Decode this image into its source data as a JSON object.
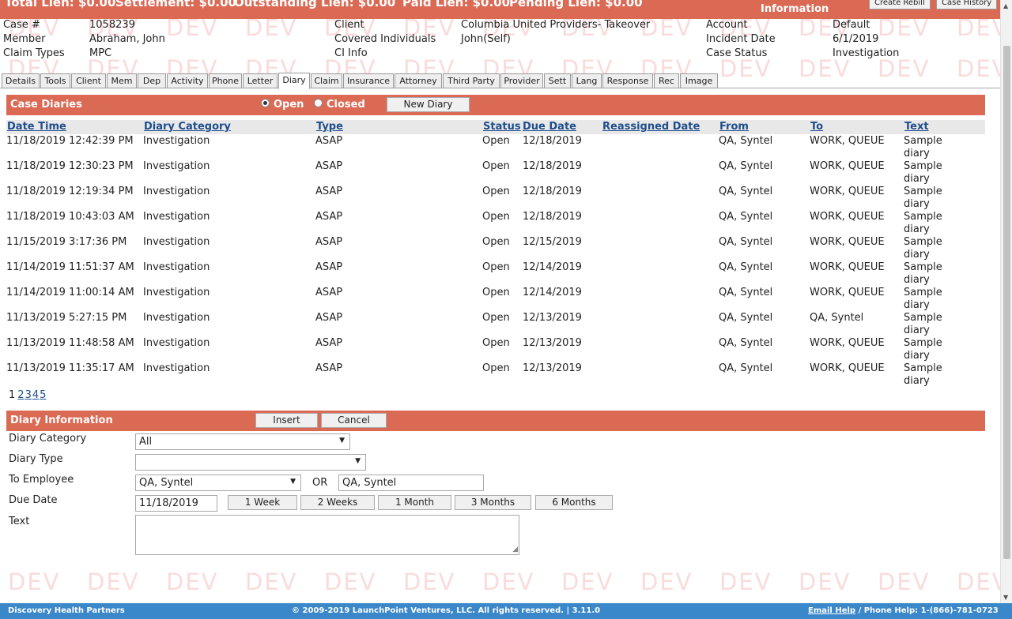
{
  "watermark": "DEV",
  "summary": {
    "total_lien": "Total Lien: $0.00",
    "settlement": "Settlement: $0.00",
    "outstanding_lien": "Outstanding Lien: $0.00",
    "paid_lien": "Paid Lien: $0.00",
    "pending_lien": "Pending Lien: $0.00",
    "information_title": "Information",
    "create_rebill": "Create Rebill",
    "case_history": "Case History"
  },
  "case_info": {
    "case_label": "Case #",
    "case_value": "1058239",
    "member_label": "Member",
    "member_value": "Abraham, John",
    "claim_types_label": "Claim Types",
    "claim_types_value": "MPC",
    "client_label": "Client",
    "client_value": "Columbia United Providers- Takeover",
    "covered_label": "Covered Individuals",
    "covered_value": "John(Self)",
    "ci_info_label": "CI Info",
    "account_label": "Account",
    "account_value": "Default",
    "incident_label": "Incident Date",
    "incident_value": "6/1/2019",
    "status_label": "Case Status",
    "status_value": "Investigation"
  },
  "tabs": [
    "Details",
    "Tools",
    "Client",
    "Mem",
    "Dep",
    "Activity",
    "Phone",
    "Letter",
    "Diary",
    "Claim",
    "Insurance",
    "Attorney",
    "Third Party",
    "Provider",
    "Sett",
    "Lang",
    "Response",
    "Rec",
    "Image"
  ],
  "case_diaries": {
    "title": "Case Diaries",
    "open_label": "Open",
    "closed_label": "Closed",
    "new_diary": "New Diary",
    "columns": [
      "Date Time",
      "Diary Category",
      "Type",
      "Status",
      "Due Date",
      "Reassigned Date",
      "From",
      "To",
      "Text"
    ],
    "rows": [
      {
        "datetime": "11/18/2019 12:42:39 PM",
        "category": "Investigation",
        "type": "ASAP",
        "status": "Open",
        "due": "12/18/2019",
        "reassigned": "",
        "from": "QA, Syntel",
        "to": "WORK, QUEUE",
        "text": "Sample diary"
      },
      {
        "datetime": "11/18/2019 12:30:23 PM",
        "category": "Investigation",
        "type": "ASAP",
        "status": "Open",
        "due": "12/18/2019",
        "reassigned": "",
        "from": "QA, Syntel",
        "to": "WORK, QUEUE",
        "text": "Sample diary"
      },
      {
        "datetime": "11/18/2019 12:19:34 PM",
        "category": "Investigation",
        "type": "ASAP",
        "status": "Open",
        "due": "12/18/2019",
        "reassigned": "",
        "from": "QA, Syntel",
        "to": "WORK, QUEUE",
        "text": "Sample diary"
      },
      {
        "datetime": "11/18/2019 10:43:03 AM",
        "category": "Investigation",
        "type": "ASAP",
        "status": "Open",
        "due": "12/18/2019",
        "reassigned": "",
        "from": "QA, Syntel",
        "to": "WORK, QUEUE",
        "text": "Sample diary"
      },
      {
        "datetime": "11/15/2019 3:17:36 PM",
        "category": "Investigation",
        "type": "ASAP",
        "status": "Open",
        "due": "12/15/2019",
        "reassigned": "",
        "from": "QA, Syntel",
        "to": "WORK, QUEUE",
        "text": "Sample diary"
      },
      {
        "datetime": "11/14/2019 11:51:37 AM",
        "category": "Investigation",
        "type": "ASAP",
        "status": "Open",
        "due": "12/14/2019",
        "reassigned": "",
        "from": "QA, Syntel",
        "to": "WORK, QUEUE",
        "text": "Sample diary"
      },
      {
        "datetime": "11/14/2019 11:00:14 AM",
        "category": "Investigation",
        "type": "ASAP",
        "status": "Open",
        "due": "12/14/2019",
        "reassigned": "",
        "from": "QA, Syntel",
        "to": "WORK, QUEUE",
        "text": "Sample diary"
      },
      {
        "datetime": "11/13/2019 5:27:15 PM",
        "category": "Investigation",
        "type": "ASAP",
        "status": "Open",
        "due": "12/13/2019",
        "reassigned": "",
        "from": "QA, Syntel",
        "to": "QA, Syntel",
        "text": "Sample diary"
      },
      {
        "datetime": "11/13/2019 11:48:58 AM",
        "category": "Investigation",
        "type": "ASAP",
        "status": "Open",
        "due": "12/13/2019",
        "reassigned": "",
        "from": "QA, Syntel",
        "to": "WORK, QUEUE",
        "text": "Sample diary"
      },
      {
        "datetime": "11/13/2019 11:35:17 AM",
        "category": "Investigation",
        "type": "ASAP",
        "status": "Open",
        "due": "12/13/2019",
        "reassigned": "",
        "from": "QA, Syntel",
        "to": "WORK, QUEUE",
        "text": "Sample diary"
      }
    ],
    "pages": [
      "1",
      "2",
      "3",
      "4",
      "5"
    ],
    "current_page": "1"
  },
  "diary_info": {
    "title": "Diary Information",
    "insert": "Insert",
    "cancel": "Cancel",
    "category_label": "Diary Category",
    "category_value": "All",
    "type_label": "Diary Type",
    "type_value": "",
    "employee_label": "To Employee",
    "employee_value": "QA, Syntel",
    "or_label": "OR",
    "employee_text": "QA, Syntel",
    "due_label": "Due Date",
    "due_value": "11/18/2019",
    "quick_dates": [
      "1 Week",
      "2 Weeks",
      "1 Month",
      "3 Months",
      "6 Months"
    ],
    "text_label": "Text",
    "text_value": ""
  },
  "footer": {
    "company": "Discovery Health Partners",
    "copyright": "© 2009-2019 LaunchPoint Ventures, LLC. All rights reserved. | 3.11.0",
    "email_help": "Email Help",
    "phone_help": "/ Phone Help: 1-(866)-781-0723"
  },
  "colors": {
    "header_bar": "#db6a55",
    "link": "#1e4e8c",
    "footer": "#3a87c9",
    "watermark": "#e65a5a"
  }
}
